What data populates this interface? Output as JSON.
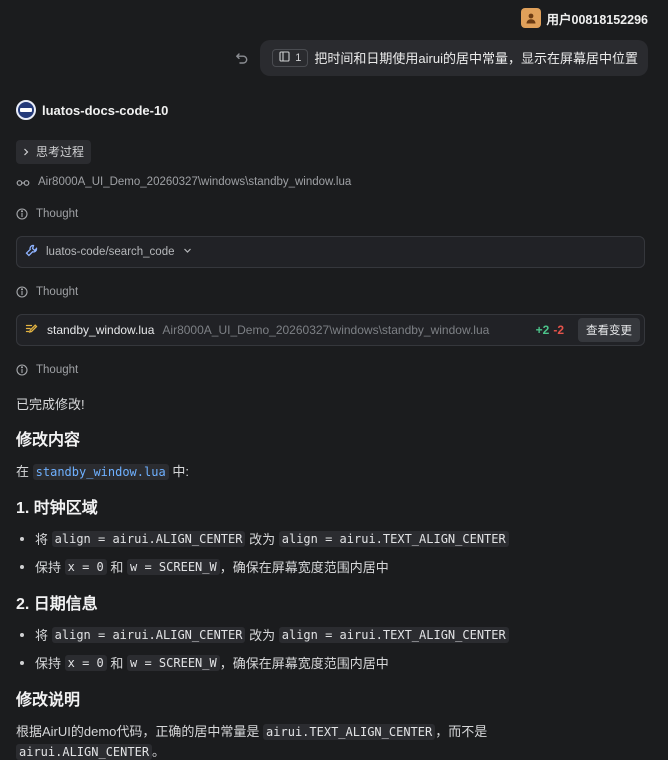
{
  "user": {
    "name": "用户00818152296"
  },
  "message": {
    "context_count": "1",
    "text": "把时间和日期使用airui的居中常量，显示在屏幕居中位置"
  },
  "agent": {
    "name": "luatos-docs-code-10"
  },
  "thinking": {
    "label": "思考过程"
  },
  "read_file": {
    "path": "Air8000A_UI_Demo_20260327\\windows\\standby_window.lua"
  },
  "thought_label": "Thought",
  "tool_call": {
    "label": "luatos-code/search_code"
  },
  "edit": {
    "file_name": "standby_window.lua",
    "file_path": "Air8000A_UI_Demo_20260327\\windows\\standby_window.lua",
    "added": "+2",
    "removed": "-2",
    "view_button": "查看变更"
  },
  "response": {
    "done": "已完成修改!",
    "h_changes": "修改内容",
    "in_prefix": "在",
    "in_file": "standby_window.lua",
    "in_suffix": "中:",
    "h_clock": "1. 时钟区域",
    "h_date": "2. 日期信息",
    "item_replace": {
      "a": "将",
      "b": "align = airui.ALIGN_CENTER",
      "c": "改为",
      "d": "align = airui.TEXT_ALIGN_CENTER"
    },
    "item_keep": {
      "a": "保持",
      "b": "x = 0",
      "c": "和",
      "d": "w = SCREEN_W",
      "e": "，确保在屏幕宽度范围内居中"
    },
    "h_notes": "修改说明",
    "notes_prefix": "根据AirUI的demo代码，正确的居中常量是",
    "notes_code1": "airui.TEXT_ALIGN_CENTER",
    "notes_mid": "，而不是",
    "notes_code2": "airui.ALIGN_CENTER",
    "notes_end": "。"
  },
  "icons": [
    "user-avatar-icon",
    "undo-icon",
    "file-context-icon",
    "agent-logo-icon",
    "chevron-right-icon",
    "glasses-icon",
    "info-icon",
    "wrench-icon",
    "chevron-down-icon",
    "edit-file-icon"
  ]
}
